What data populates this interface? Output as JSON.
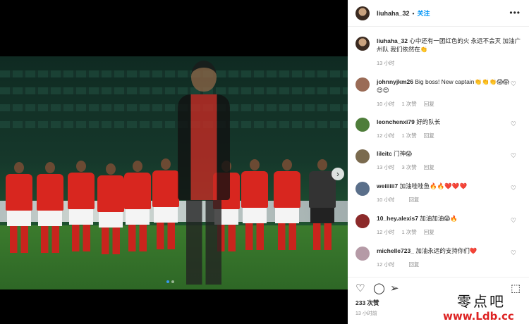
{
  "post": {
    "username": "liuhaha_32",
    "follow_label": "关注",
    "separator": "•",
    "more_label": "•••",
    "caption": {
      "username": "liuhaha_32",
      "text": "心中还有一团红色的火 永远不会灭 加油广州队 我们依然在👏",
      "time": "13 小时"
    },
    "media": {
      "next_arrow": "›",
      "slides": 2,
      "active_slide": 1
    }
  },
  "comments": [
    {
      "username": "johnnyjkm26",
      "text": "Big boss! New captain👏👏👏😱😱😍😍",
      "time": "10 小时",
      "likes": "1 次赞",
      "reply": "回复",
      "avatar_color": "#9a6b56"
    },
    {
      "username": "leonchenxi79",
      "text": "好的队长",
      "time": "12 小时",
      "likes": "1 次赞",
      "reply": "回复",
      "avatar_color": "#4e7d3a"
    },
    {
      "username": "lileitc",
      "text": "门神😱",
      "time": "13 小时",
      "likes": "3 次赞",
      "reply": "回复",
      "avatar_color": "#7a6a4e"
    },
    {
      "username": "weiiiiii7",
      "text": "加油哇哇鱼🔥🔥❤️❤️❤️",
      "time": "10 小时",
      "likes": "",
      "reply": "回复",
      "avatar_color": "#5a6f8a"
    },
    {
      "username": "10_hey.alexis7",
      "text": "加油加油😱🔥",
      "time": "12 小时",
      "likes": "1 次赞",
      "reply": "回复",
      "avatar_color": "#8c2a2a"
    },
    {
      "username": "michelle723_",
      "text": "加油永远的支持你们❤️",
      "time": "12 小时",
      "likes": "",
      "reply": "回复",
      "avatar_color": "#b59aa6"
    }
  ],
  "actions": {
    "like_icon": "heart-icon",
    "comment_icon": "comment-icon",
    "share_icon": "share-icon",
    "save_icon": "bookmark-icon"
  },
  "likes_text": "233 次赞",
  "posted_time": "13 小时前",
  "watermark": {
    "top": "零点吧",
    "bottom": "www.Ldb.cc"
  }
}
